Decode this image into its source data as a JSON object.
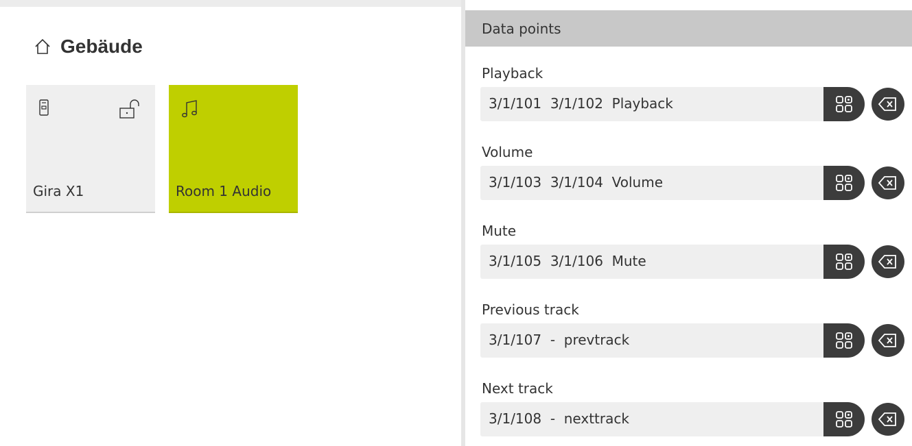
{
  "building": {
    "title": "Gebäude",
    "icon": "home-icon",
    "tiles": [
      {
        "label": "Gira X1",
        "icons": [
          "device-icon",
          "unlock-icon"
        ],
        "color": "#efefef"
      },
      {
        "label": "Room 1 Audio",
        "icons": [
          "music-note-icon"
        ],
        "color": "#bfcf00"
      }
    ]
  },
  "datapoints": {
    "header": "Data points",
    "items": [
      {
        "label": "Playback",
        "value": "3/1/101  3/1/102  Playback"
      },
      {
        "label": "Volume",
        "value": "3/1/103  3/1/104  Volume"
      },
      {
        "label": "Mute",
        "value": "3/1/105  3/1/106  Mute"
      },
      {
        "label": "Previous track",
        "value": "3/1/107  -  prevtrack"
      },
      {
        "label": "Next track",
        "value": "3/1/108  -  nexttrack"
      }
    ]
  },
  "colors": {
    "accent": "#bfcf00",
    "dark_button": "#3c3c3c",
    "header_bg": "#c8c8c8"
  }
}
